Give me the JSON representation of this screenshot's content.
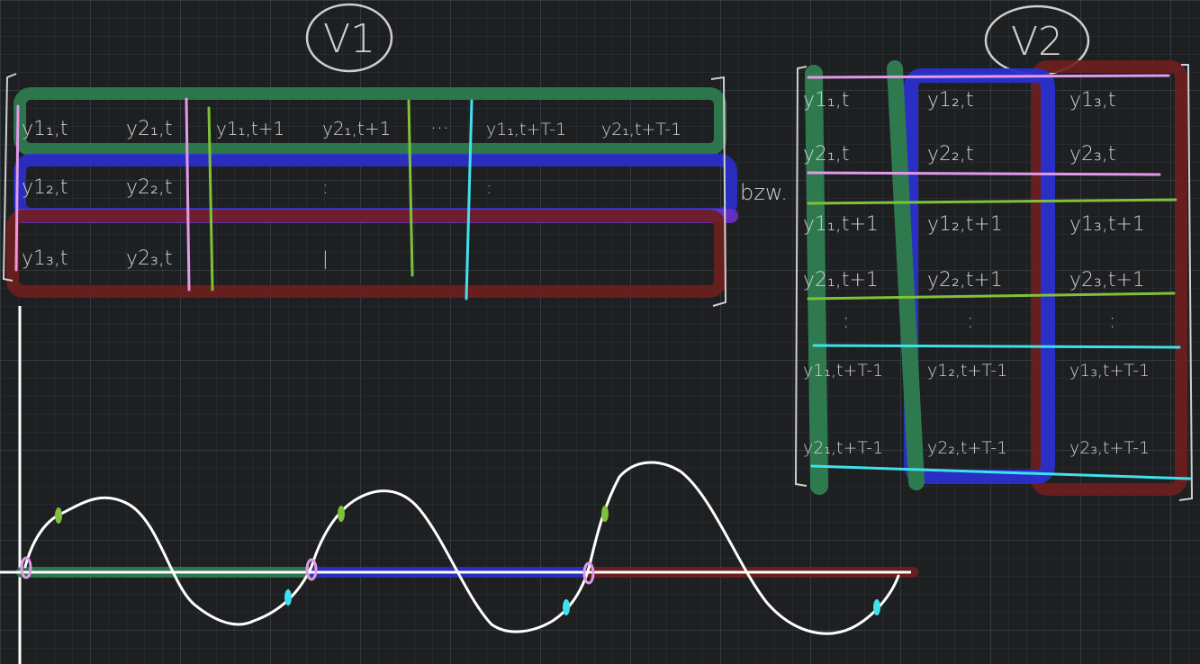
{
  "labels": {
    "v1": "V1",
    "v2": "V2",
    "bzw": "bzw."
  },
  "matrix_v1": {
    "rows": [
      [
        "y1₁,t",
        "y2₁,t",
        "y1₁,t+1",
        "y2₁,t+1",
        "···",
        "y1₁,t+T-1",
        "y2₁,t+T-1"
      ],
      [
        "y1₂,t",
        "y2₂,t",
        "",
        ":",
        "",
        ":",
        ""
      ],
      [
        "y1₃,t",
        "y2₃,t",
        "",
        "|",
        "",
        "",
        ""
      ]
    ]
  },
  "matrix_v2": {
    "rows": [
      [
        "y1₁,t",
        "y1₂,t",
        "y1₃,t"
      ],
      [
        "y2₁,t",
        "y2₂,t",
        "y2₃,t"
      ],
      [
        "y1₁,t+1",
        "y1₂,t+1",
        "y1₃,t+1"
      ],
      [
        "y2₁,t+1",
        "y2₂,t+1",
        "y2₃,t+1"
      ],
      [
        ":",
        ":",
        ":"
      ],
      [
        "y1₁,t+T-1",
        "y1₂,t+T-1",
        "y1₃,t+T-1"
      ],
      [
        "y2₁,t+T-1",
        "y2₂,t+T-1",
        "y2₃,t+T-1"
      ]
    ]
  },
  "colors": {
    "green": "#2e7a4e",
    "blue": "#2a2fcf",
    "purple": "#6b2fc7",
    "red": "#6e1e1e",
    "pink": "#e29ae8",
    "lime": "#7fc13a",
    "cyan": "#3fe1ec",
    "chalk": "#ffffff",
    "text": "#cfcfcf"
  }
}
